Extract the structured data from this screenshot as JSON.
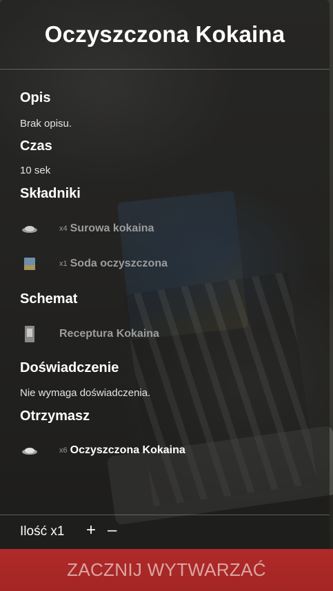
{
  "title": "Oczyszczona Kokaina",
  "description": {
    "heading": "Opis",
    "text": "Brak opisu."
  },
  "time": {
    "heading": "Czas",
    "text": "10 sek"
  },
  "ingredients": {
    "heading": "Składniki",
    "items": [
      {
        "qty": "x4",
        "name": "Surowa kokaina",
        "icon": "powder-pile-icon"
      },
      {
        "qty": "x1",
        "name": "Soda oczyszczona",
        "icon": "soda-box-icon"
      }
    ]
  },
  "schematic": {
    "heading": "Schemat",
    "name": "Receptura Kokaina",
    "icon": "recipe-document-icon"
  },
  "experience": {
    "heading": "Doświadczenie",
    "text": "Nie wymaga doświadczenia."
  },
  "output": {
    "heading": "Otrzymasz",
    "qty": "x6",
    "name": "Oczyszczona Kokaina",
    "icon": "powder-pile-icon"
  },
  "footer": {
    "amount_label": "Ilość x1",
    "plus": "+",
    "minus": "–"
  },
  "start_button": "ZACZNIJ WYTWARZAĆ"
}
